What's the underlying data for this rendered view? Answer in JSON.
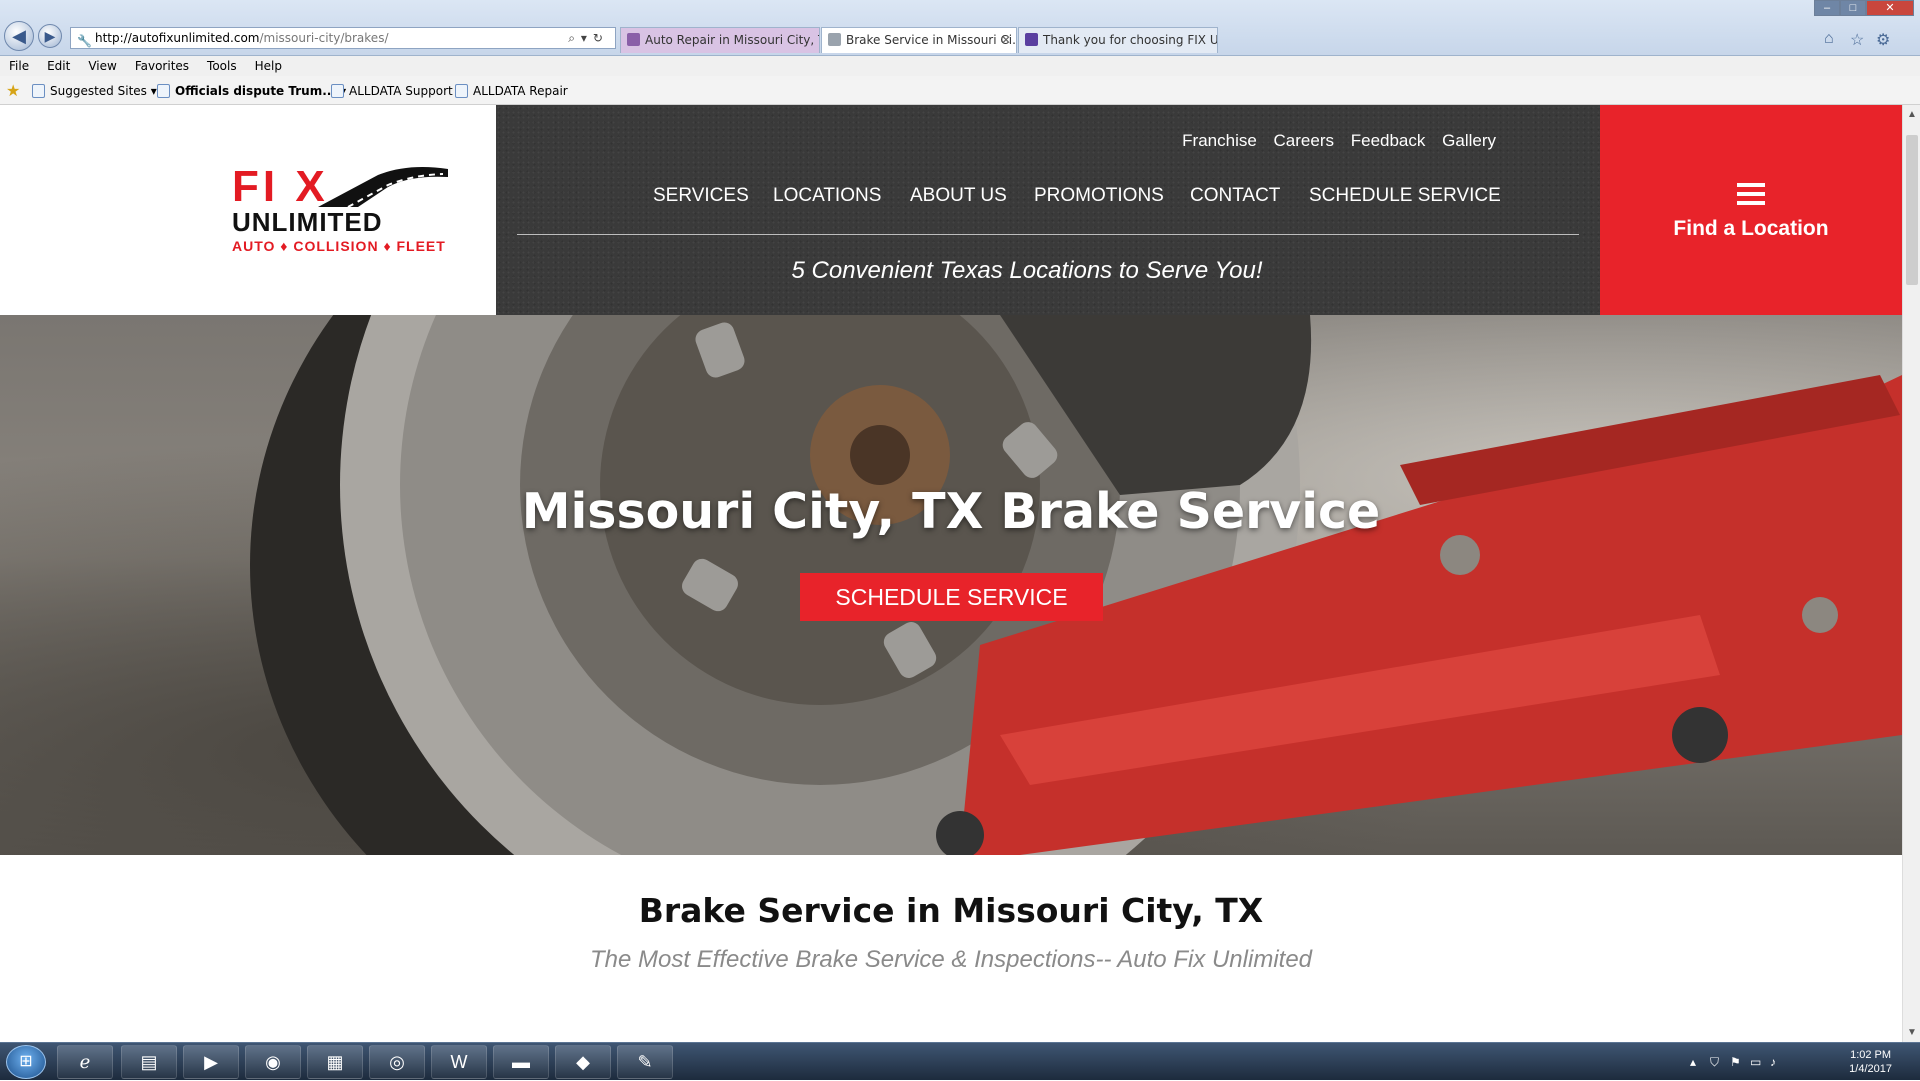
{
  "browser": {
    "url_domain": "http://autofixunlimited.com",
    "url_path": "/missouri-city/brakes/",
    "tabs": [
      {
        "title": "Auto Repair in Missouri City, T...",
        "active": false,
        "color": "#c9a7d8"
      },
      {
        "title": "Brake Service in Missouri Ci...",
        "active": true,
        "color": "#ffffff"
      },
      {
        "title": "Thank you for choosing FIX Un...",
        "active": false,
        "color": "#dfe7f2"
      }
    ],
    "close_tab_glyph": "✕",
    "menu": [
      "File",
      "Edit",
      "View",
      "Favorites",
      "Tools",
      "Help"
    ],
    "favorites": [
      {
        "label": "Suggested Sites",
        "dropdown": true,
        "bold": false
      },
      {
        "label": "Officials dispute Trum...",
        "dropdown": true,
        "bold": true
      },
      {
        "label": "ALLDATA Support",
        "dropdown": false,
        "bold": false
      },
      {
        "label": "ALLDATA Repair",
        "dropdown": false,
        "bold": false
      }
    ]
  },
  "site": {
    "logo": {
      "fix": "FI X",
      "unlimited": "UNLIMITED",
      "tagline": "AUTO ♦ COLLISION ♦ FLEET"
    },
    "utility_nav": [
      "Franchise",
      "Careers",
      "Feedback",
      "Gallery"
    ],
    "main_nav": [
      "SERVICES",
      "LOCATIONS",
      "ABOUT US",
      "PROMOTIONS",
      "CONTACT",
      "SCHEDULE SERVICE"
    ],
    "header_tagline": "5 Convenient Texas Locations to Serve You!",
    "find_location": "Find a Location",
    "hero": {
      "title": "Missouri City, TX Brake Service",
      "button": "SCHEDULE SERVICE"
    },
    "content": {
      "heading": "Brake Service in Missouri City, TX",
      "subheading": "The Most Effective Brake Service & Inspections-- Auto Fix Unlimited"
    },
    "colors": {
      "brand_red": "#e8232a",
      "header_dark": "#3a3a3a"
    }
  },
  "taskbar": {
    "time": "1:02 PM",
    "date": "1/4/2017"
  }
}
